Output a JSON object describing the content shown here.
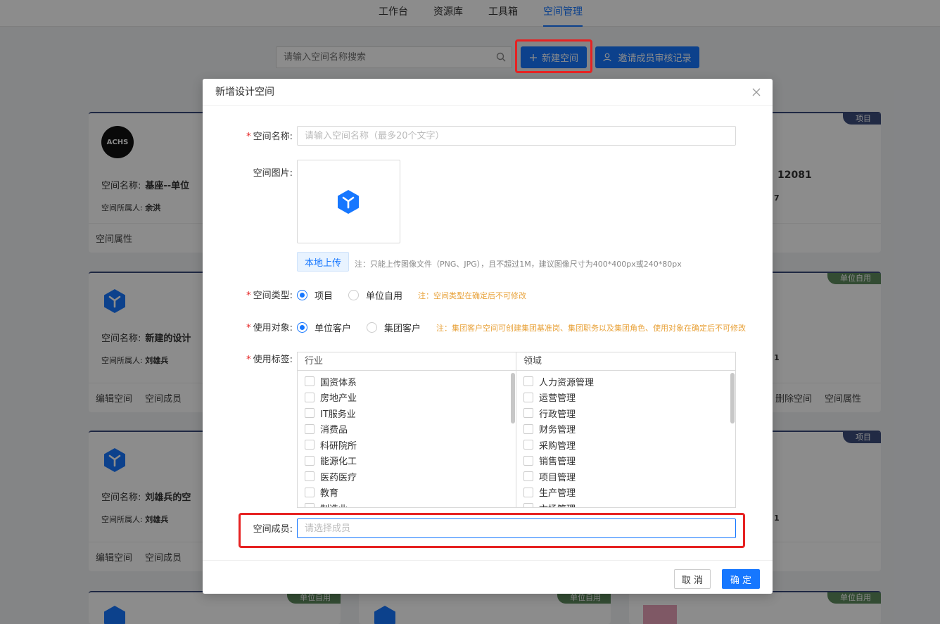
{
  "topnav": {
    "tabs": [
      "工作台",
      "资源库",
      "工具箱",
      "空间管理"
    ]
  },
  "toolbar": {
    "search_placeholder": "请输入空间名称搜索",
    "new_space_label": "新建空间",
    "invite_label": "邀请成员审核记录"
  },
  "cards": {
    "c1": {
      "tag": "项目",
      "logo_text": "ACHS",
      "name_label": "空间名称:",
      "name": "基座--单位",
      "owner_label": "空间所属人:",
      "owner": "余洪",
      "action": "空间属性"
    },
    "c2": {
      "tag": "单位自用",
      "name_label": "空间名称:",
      "name": "新建的设计",
      "owner_label": "空间所属人:",
      "owner": "刘雄兵",
      "action1": "编辑空间",
      "action2": "空间成员"
    },
    "c3": {
      "tag": "项目",
      "name_label": "空间名称:",
      "name": "刘雄兵的空",
      "owner_label": "空间所属人:",
      "owner": "刘雄兵",
      "action1": "编辑空间",
      "action2": "空间成员"
    },
    "r1": {
      "tag": "项目",
      "name": "12081",
      "owner": "7"
    },
    "r2": {
      "tag": "单位自用",
      "owner": "1",
      "action1": "删除空间",
      "action2": "空间属性"
    },
    "r3": {
      "tag": "项目",
      "owner": "1"
    },
    "b1": {
      "tag": "单位自用"
    },
    "b2": {
      "tag": "单位自用"
    },
    "b3": {
      "tag": "单位自用"
    }
  },
  "modal": {
    "title": "新增设计空间",
    "name_label": "空间名称:",
    "name_placeholder": "请输入空间名称（最多20个文字）",
    "image_label": "空间图片:",
    "upload_label": "本地上传",
    "upload_note": "注：只能上传图像文件（PNG、JPG），且不超过1M，建议图像尺寸为400*400px或240*80px",
    "type_label": "空间类型:",
    "type_options": [
      "项目",
      "单位自用"
    ],
    "type_selected": "项目",
    "type_note": "注：空间类型在确定后不可修改",
    "target_label": "使用对象:",
    "target_options": [
      "单位客户",
      "集团客户"
    ],
    "target_selected": "单位客户",
    "target_note": "注：集团客户空间可创建集团基准岗、集团职务以及集团角色、使用对象在确定后不可修改",
    "tags_label": "使用标签:",
    "industry_header": "行业",
    "industry_items": [
      "国资体系",
      "房地产业",
      "IT服务业",
      "消费品",
      "科研院所",
      "能源化工",
      "医药医疗",
      "教育",
      "制造业"
    ],
    "domain_header": "领域",
    "domain_items": [
      "人力资源管理",
      "运营管理",
      "行政管理",
      "财务管理",
      "采购管理",
      "销售管理",
      "项目管理",
      "生产管理",
      "市场管理"
    ],
    "member_label": "空间成员:",
    "member_placeholder": "请选择成员",
    "cancel_label": "取 消",
    "ok_label": "确 定"
  },
  "colors": {
    "primary": "#1677ff",
    "highlight": "#e62222",
    "note": "#e8a23a"
  }
}
